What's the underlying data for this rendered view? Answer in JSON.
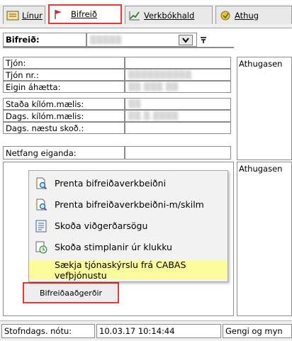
{
  "tabs": [
    {
      "label": "Línur",
      "icon": "lines-icon"
    },
    {
      "label": "Bifreið",
      "icon": "red-flag-icon",
      "active": true
    },
    {
      "label": "Verkbókhald",
      "icon": "chart-icon"
    },
    {
      "label": "Athug",
      "icon": "note-icon"
    }
  ],
  "vehicle": {
    "label": "Bifreið:",
    "value": "▒▒▒▒▒",
    "dropdown_icon": "chevron-down-icon",
    "extra_icon": "pin-icon"
  },
  "fields": [
    {
      "label": "Tjón:",
      "value": ""
    },
    {
      "label": "Tjón nr.:",
      "value": "▒▒▒▒▒▒▒▒▒▒"
    },
    {
      "label": "Eigin áhætta:",
      "value": "▒▒ ▒▒▒ ▒▒"
    },
    {
      "label": "Staða kílóm.mælis:",
      "value": "▒▒"
    },
    {
      "label": "Dags. kílóm.mælis:",
      "value": "▒▒.▒.▒▒▒▒"
    },
    {
      "label": "Dags. næstu skoð.:",
      "value": ""
    },
    {
      "label": "Netfang eiganda:",
      "value": ""
    }
  ],
  "notes": {
    "top_label": "Athugasen",
    "bottom_label": "Athugasen"
  },
  "menu": {
    "items": [
      {
        "label": "Prenta bifreiðaverkbeiðni",
        "icon": "print-preview-icon",
        "highlighted": false
      },
      {
        "label": "Prenta bifreiðaverkbeiðni-m/skilm",
        "icon": "print-preview-icon",
        "highlighted": false
      },
      {
        "label": "Skoða viðgerðarsögu",
        "icon": "document-list-icon",
        "highlighted": false
      },
      {
        "label": "Skoða stimplanir úr klukku",
        "icon": "clock-doc-icon",
        "highlighted": false
      },
      {
        "label": "Sækja tjónaskýrslu frá CABAS vefþjónustu",
        "icon": "",
        "highlighted": true
      }
    ],
    "highlight_color": "#fbfb9c"
  },
  "actions_button": "Bifreiðaaðgerðir",
  "status": {
    "created_label": "Stofndags. nótu:",
    "created_value": "10.03.17 10:14:44",
    "currency_label": "Gengi og myn"
  },
  "accent_color": "#e53935"
}
